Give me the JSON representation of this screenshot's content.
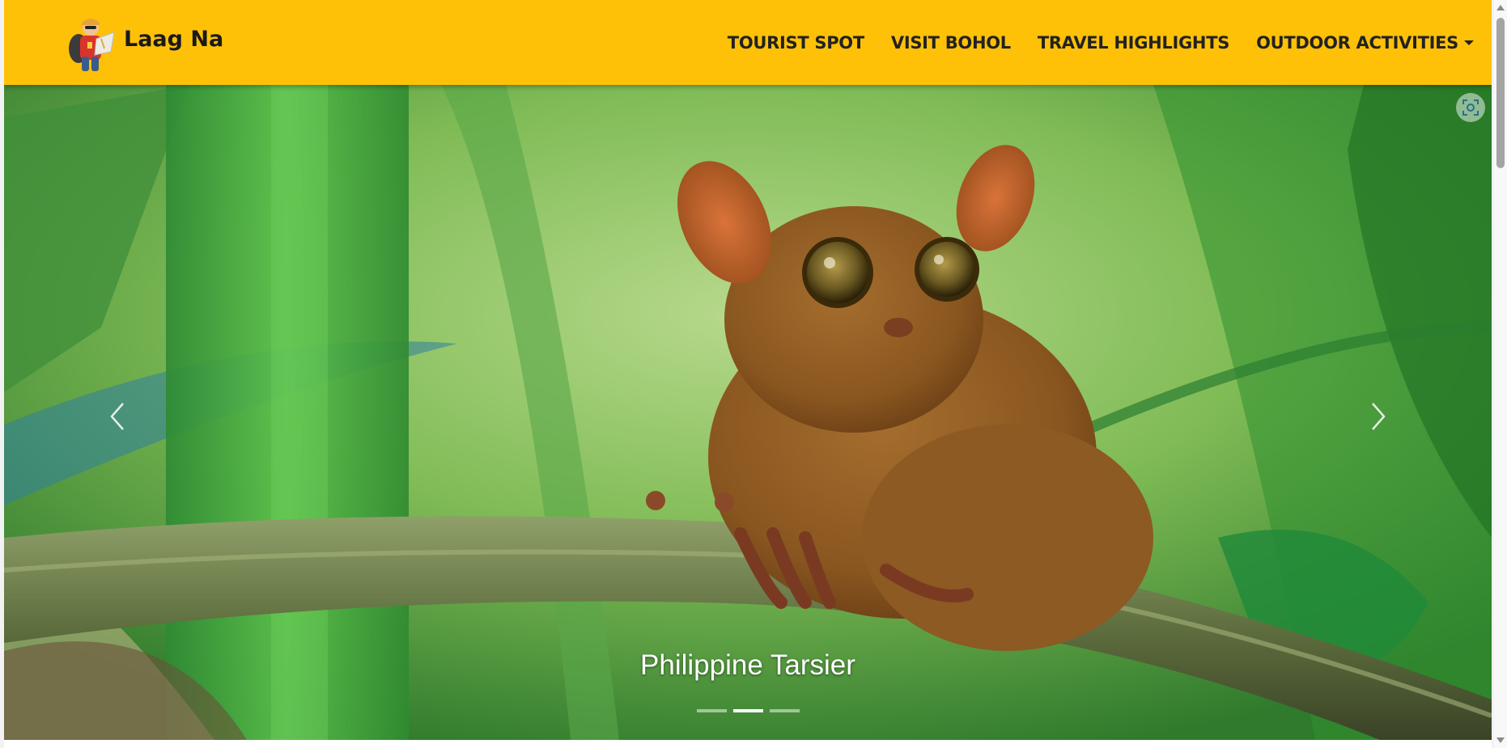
{
  "brand": {
    "name": "Laag Na",
    "logo_icon": "backpacker-icon"
  },
  "nav": [
    {
      "label": "TOURIST SPOT",
      "has_dropdown": false
    },
    {
      "label": "VISIT BOHOL",
      "has_dropdown": false
    },
    {
      "label": "TRAVEL HIGHLIGHTS",
      "has_dropdown": false
    },
    {
      "label": "OUTDOOR ACTIVITIES",
      "has_dropdown": true
    }
  ],
  "carousel": {
    "caption": "Philippine Tarsier",
    "slide_count": 3,
    "active_index": 1,
    "prev_icon": "chevron-left-icon",
    "next_icon": "chevron-right-icon",
    "overlay_icon": "visual-search-icon"
  },
  "colors": {
    "navbar": "#ffc107",
    "nav_text": "#222222",
    "caption": "#ffffff"
  }
}
